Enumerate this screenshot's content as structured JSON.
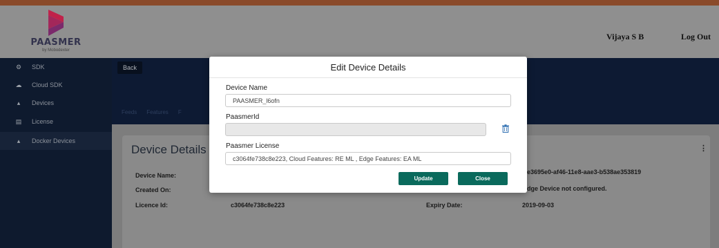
{
  "header": {
    "brand": "PAASMER",
    "brand_sub": "by Mobodexter",
    "user_name": "Vijaya S B",
    "logout_label": "Log Out"
  },
  "sidebar": {
    "items": [
      {
        "label": "SDK",
        "icon": "cogs-icon"
      },
      {
        "label": "Cloud SDK",
        "icon": "cloud-icon"
      },
      {
        "label": "Devices",
        "icon": "sitemap-icon"
      },
      {
        "label": "License",
        "icon": "file-icon"
      },
      {
        "label": "Docker Devices",
        "icon": "sitemap-icon",
        "active": true
      }
    ]
  },
  "main": {
    "back_label": "Back",
    "tabs": [
      "Feeds",
      "Features",
      "F"
    ],
    "card": {
      "title": "Device Details",
      "device_name_label": "Device Name:",
      "created_on_label": "Created On:",
      "licence_id_label": "Licence Id:",
      "licence_id_value": "c3064fe738c8e223",
      "expiry_label": "Expiry Date:",
      "expiry_value": "2019-09-03",
      "device_id_value": "e3695e0-af46-11e8-aae3-b538ae353819",
      "edge_status_value": "dge Device not configured."
    }
  },
  "modal": {
    "title": "Edit Device Details",
    "device_name_label": "Device Name",
    "device_name_value": "PAASMER_l6ofn",
    "paasmer_id_label": "PaasmerId",
    "paasmer_id_value": "",
    "license_label": "Paasmer License",
    "license_value": "c3064fe738c8e223, Cloud Features: RE ML , Edge Features: EA ML",
    "update_label": "Update",
    "close_label": "Close"
  },
  "colors": {
    "header_bg": "#8f8f8f",
    "sidebar_bg": "#0e1a2e",
    "main_band_bg": "#0d1a33",
    "button_green": "#0a6a5c",
    "trash_icon": "#2b6cb0"
  }
}
